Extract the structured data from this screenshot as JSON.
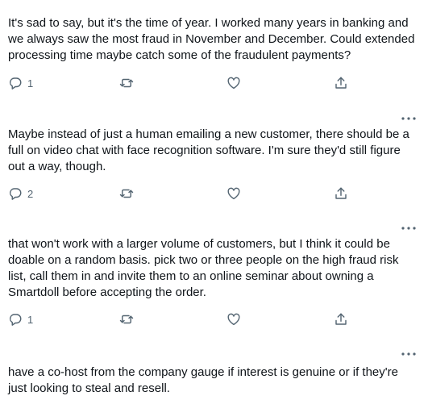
{
  "tweets": [
    {
      "text": "It's sad to say, but it's the time of year. I worked many years in banking and\nwe always saw the most fraud in November and December. Could extended\nprocessing time maybe catch some of the fraudulent payments?",
      "reply_count": "1",
      "icons": [
        "reply-icon",
        "retweet-icon",
        "like-icon",
        "share-icon"
      ]
    },
    {
      "text": "Maybe instead of just a human emailing a new customer, there should be a\nfull on video chat with face recognition software. I'm sure they'd still figure\nout a way, though.",
      "reply_count": "2",
      "icons": [
        "reply-icon",
        "retweet-icon",
        "like-icon",
        "share-icon"
      ]
    },
    {
      "text": "that won't work with a larger volume of customers, but I think it could be\ndoable on a random basis. pick two or three people on the high fraud risk\nlist, call them in and invite them to an online seminar about owning a\nSmartdoll before accepting the order.",
      "reply_count": "1",
      "icons": [
        "reply-icon",
        "retweet-icon",
        "like-icon",
        "share-icon"
      ]
    },
    {
      "text": "have a co-host from the company gauge if interest is genuine or if they're\njust looking to steal and resell.",
      "icons": [
        "more-icon"
      ]
    }
  ],
  "colors": {
    "text": "#0f1419",
    "icon": "#536471"
  }
}
